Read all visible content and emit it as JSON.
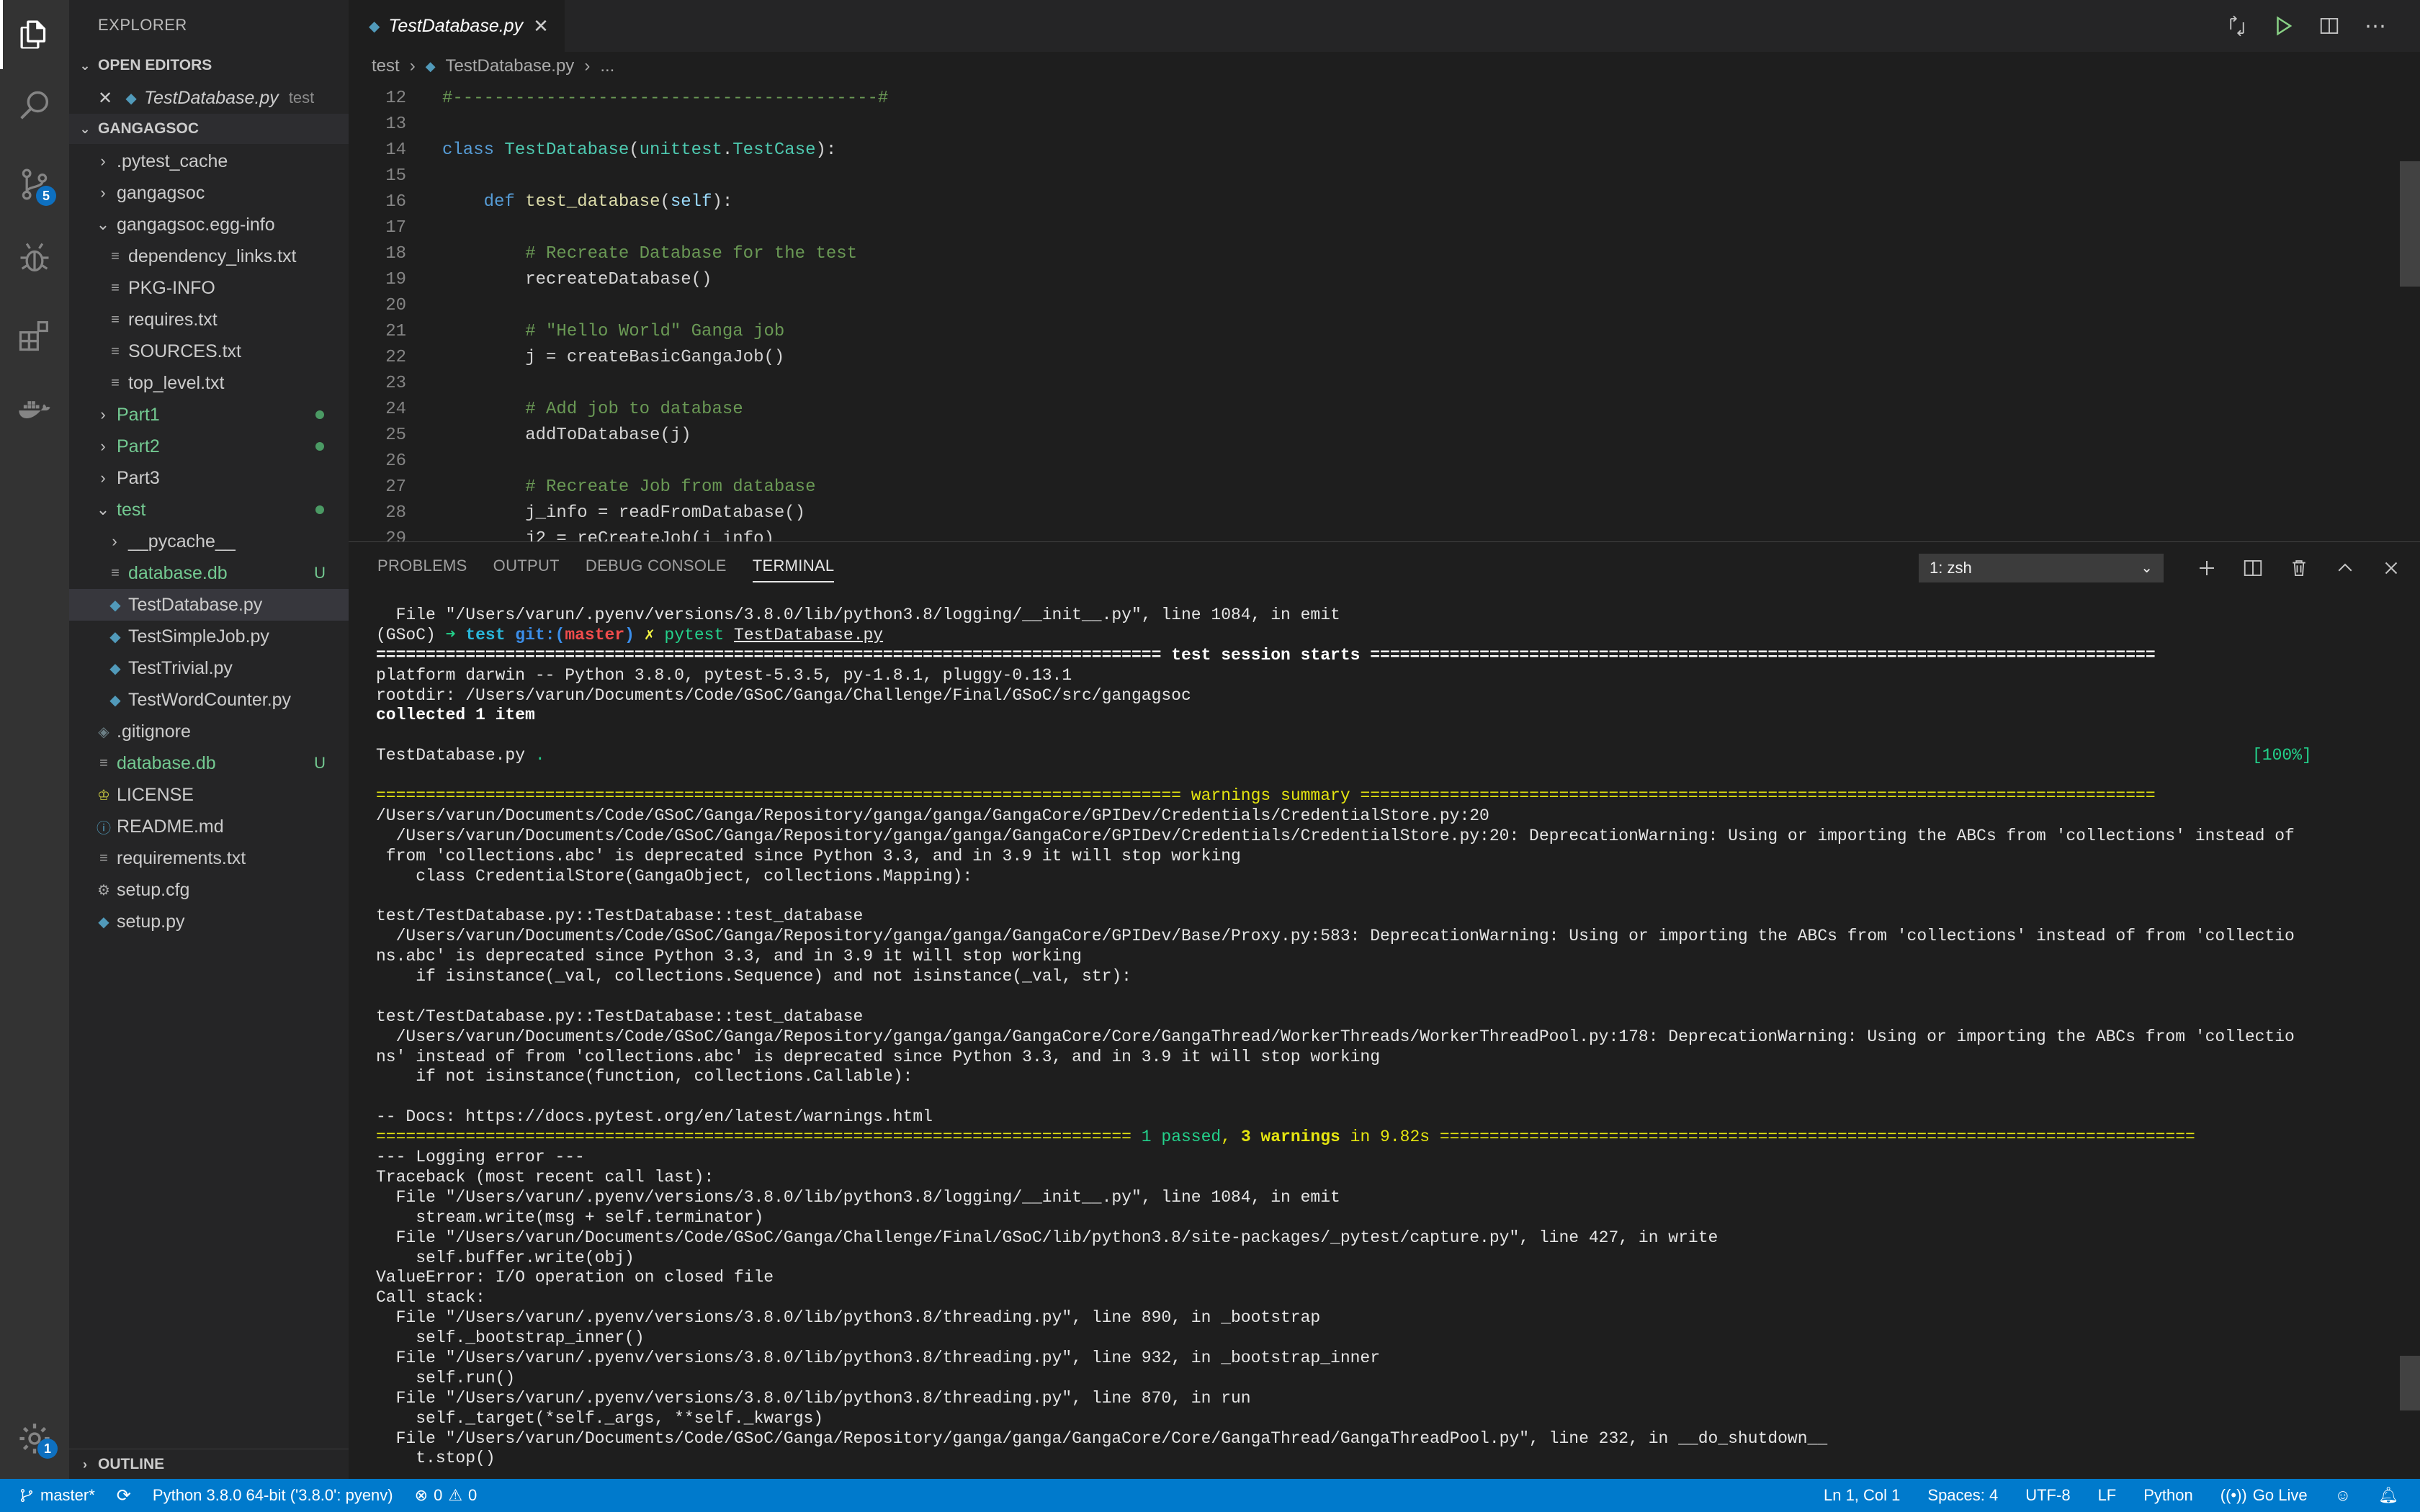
{
  "activity": {
    "scm_badge": "5",
    "settings_badge": "1"
  },
  "explorer": {
    "title": "EXPLORER",
    "open_editors_label": "OPEN EDITORS",
    "open_editor_file": "TestDatabase.py",
    "open_editor_desc": "test",
    "project_label": "GANGAGSOC",
    "items": [
      {
        "label": ".pytest_cache"
      },
      {
        "label": "gangagsoc"
      },
      {
        "label": "gangagsoc.egg-info"
      },
      {
        "label": "dependency_links.txt"
      },
      {
        "label": "PKG-INFO"
      },
      {
        "label": "requires.txt"
      },
      {
        "label": "SOURCES.txt"
      },
      {
        "label": "top_level.txt"
      },
      {
        "label": "Part1"
      },
      {
        "label": "Part2"
      },
      {
        "label": "Part3"
      },
      {
        "label": "test"
      },
      {
        "label": "__pycache__"
      },
      {
        "label": "database.db",
        "badge": "U"
      },
      {
        "label": "TestDatabase.py"
      },
      {
        "label": "TestSimpleJob.py"
      },
      {
        "label": "TestTrivial.py"
      },
      {
        "label": "TestWordCounter.py"
      },
      {
        "label": ".gitignore"
      },
      {
        "label": "database.db",
        "badge": "U"
      },
      {
        "label": "LICENSE"
      },
      {
        "label": "README.md"
      },
      {
        "label": "requirements.txt"
      },
      {
        "label": "setup.cfg"
      },
      {
        "label": "setup.py"
      }
    ],
    "outline_label": "OUTLINE"
  },
  "editor": {
    "tab_label": "TestDatabase.py",
    "breadcrumb": [
      "test",
      "TestDatabase.py",
      "..."
    ],
    "lines": [
      {
        "n": "12",
        "text": "#-----------------------------------------#"
      },
      {
        "n": "13",
        "text": ""
      },
      {
        "n": "14",
        "text": "class TestDatabase(unittest.TestCase):"
      },
      {
        "n": "15",
        "text": ""
      },
      {
        "n": "16",
        "text": "    def test_database(self):"
      },
      {
        "n": "17",
        "text": ""
      },
      {
        "n": "18",
        "text": "        # Recreate Database for the test"
      },
      {
        "n": "19",
        "text": "        recreateDatabase()"
      },
      {
        "n": "20",
        "text": ""
      },
      {
        "n": "21",
        "text": "        # \"Hello World\" Ganga job"
      },
      {
        "n": "22",
        "text": "        j = createBasicGangaJob()"
      },
      {
        "n": "23",
        "text": ""
      },
      {
        "n": "24",
        "text": "        # Add job to database"
      },
      {
        "n": "25",
        "text": "        addToDatabase(j)"
      },
      {
        "n": "26",
        "text": ""
      },
      {
        "n": "27",
        "text": "        # Recreate Job from database"
      },
      {
        "n": "28",
        "text": "        j_info = readFromDatabase()"
      },
      {
        "n": "29",
        "text": "        j2 = reCreateJob(j_info)"
      }
    ]
  },
  "panel": {
    "tabs": [
      "PROBLEMS",
      "OUTPUT",
      "DEBUG CONSOLE",
      "TERMINAL"
    ],
    "terminal_selector": "1: zsh",
    "terminal": {
      "l01": "  File \"/Users/varun/.pyenv/versions/3.8.0/lib/python3.8/logging/__init__.py\", line 1084, in emit",
      "l02_prefix": "(GSoC) ",
      "l02_arrow": "➜ ",
      "l02_dir": "test ",
      "l02_git": "git:(",
      "l02_branch": "master",
      "l02_git_close": ") ",
      "l02_x": "✗ ",
      "l02_cmd": "pytest ",
      "l02_file": "TestDatabase.py",
      "l03_left": "=============================================================================== ",
      "l03_mid": "test session starts",
      "l03_right": " ===============================================================================",
      "l04": "platform darwin -- Python 3.8.0, pytest-5.3.5, py-1.8.1, pluggy-0.13.1",
      "l05": "rootdir: /Users/varun/Documents/Code/GSoC/Ganga/Challenge/Final/GSoC/src/gangagsoc",
      "l06": "collected 1 item",
      "l07": "",
      "l08_left": "TestDatabase.py ",
      "l08_dot": ".",
      "l08_pct": "[100%]",
      "l09": "",
      "l10_left": "================================================================================= ",
      "l10_mid": "warnings summary",
      "l10_right": " ================================================================================",
      "l11": "/Users/varun/Documents/Code/GSoC/Ganga/Repository/ganga/ganga/GangaCore/GPIDev/Credentials/CredentialStore.py:20",
      "l12": "  /Users/varun/Documents/Code/GSoC/Ganga/Repository/ganga/ganga/GangaCore/GPIDev/Credentials/CredentialStore.py:20: DeprecationWarning: Using or importing the ABCs from 'collections' instead of",
      "l13": " from 'collections.abc' is deprecated since Python 3.3, and in 3.9 it will stop working",
      "l14": "    class CredentialStore(GangaObject, collections.Mapping):",
      "l15": "",
      "l16": "test/TestDatabase.py::TestDatabase::test_database",
      "l17": "  /Users/varun/Documents/Code/GSoC/Ganga/Repository/ganga/ganga/GangaCore/GPIDev/Base/Proxy.py:583: DeprecationWarning: Using or importing the ABCs from 'collections' instead of from 'collectio",
      "l18": "ns.abc' is deprecated since Python 3.3, and in 3.9 it will stop working",
      "l19": "    if isinstance(_val, collections.Sequence) and not isinstance(_val, str):",
      "l20": "",
      "l21": "test/TestDatabase.py::TestDatabase::test_database",
      "l22": "  /Users/varun/Documents/Code/GSoC/Ganga/Repository/ganga/ganga/GangaCore/Core/GangaThread/WorkerThreads/WorkerThreadPool.py:178: DeprecationWarning: Using or importing the ABCs from 'collectio",
      "l23": "ns' instead of from 'collections.abc' is deprecated since Python 3.3, and in 3.9 it will stop working",
      "l24": "    if not isinstance(function, collections.Callable):",
      "l25": "",
      "l26": "-- Docs: https://docs.pytest.org/en/latest/warnings.html",
      "l27_left": "============================================================================ ",
      "l27_passed": "1 passed",
      "l27_comma": ", ",
      "l27_warn": "3 warnings",
      "l27_time": " in 9.82s",
      "l27_right": " ============================================================================",
      "l28": "--- Logging error ---",
      "l29": "Traceback (most recent call last):",
      "l30": "  File \"/Users/varun/.pyenv/versions/3.8.0/lib/python3.8/logging/__init__.py\", line 1084, in emit",
      "l31": "    stream.write(msg + self.terminator)",
      "l32": "  File \"/Users/varun/Documents/Code/GSoC/Ganga/Challenge/Final/GSoC/lib/python3.8/site-packages/_pytest/capture.py\", line 427, in write",
      "l33": "    self.buffer.write(obj)",
      "l34": "ValueError: I/O operation on closed file",
      "l35": "Call stack:",
      "l36": "  File \"/Users/varun/.pyenv/versions/3.8.0/lib/python3.8/threading.py\", line 890, in _bootstrap",
      "l37": "    self._bootstrap_inner()",
      "l38": "  File \"/Users/varun/.pyenv/versions/3.8.0/lib/python3.8/threading.py\", line 932, in _bootstrap_inner",
      "l39": "    self.run()",
      "l40": "  File \"/Users/varun/.pyenv/versions/3.8.0/lib/python3.8/threading.py\", line 870, in run",
      "l41": "    self._target(*self._args, **self._kwargs)",
      "l42": "  File \"/Users/varun/Documents/Code/GSoC/Ganga/Repository/ganga/ganga/GangaCore/Core/GangaThread/GangaThreadPool.py\", line 232, in __do_shutdown__",
      "l43": "    t.stop()"
    }
  },
  "statusbar": {
    "branch": "master*",
    "interpreter": "Python 3.8.0 64-bit ('3.8.0': pyenv)",
    "errors": "0",
    "warnings": "0",
    "position": "Ln 1, Col 1",
    "spaces": "Spaces: 4",
    "encoding": "UTF-8",
    "eol": "LF",
    "language": "Python",
    "golive": "Go Live"
  }
}
